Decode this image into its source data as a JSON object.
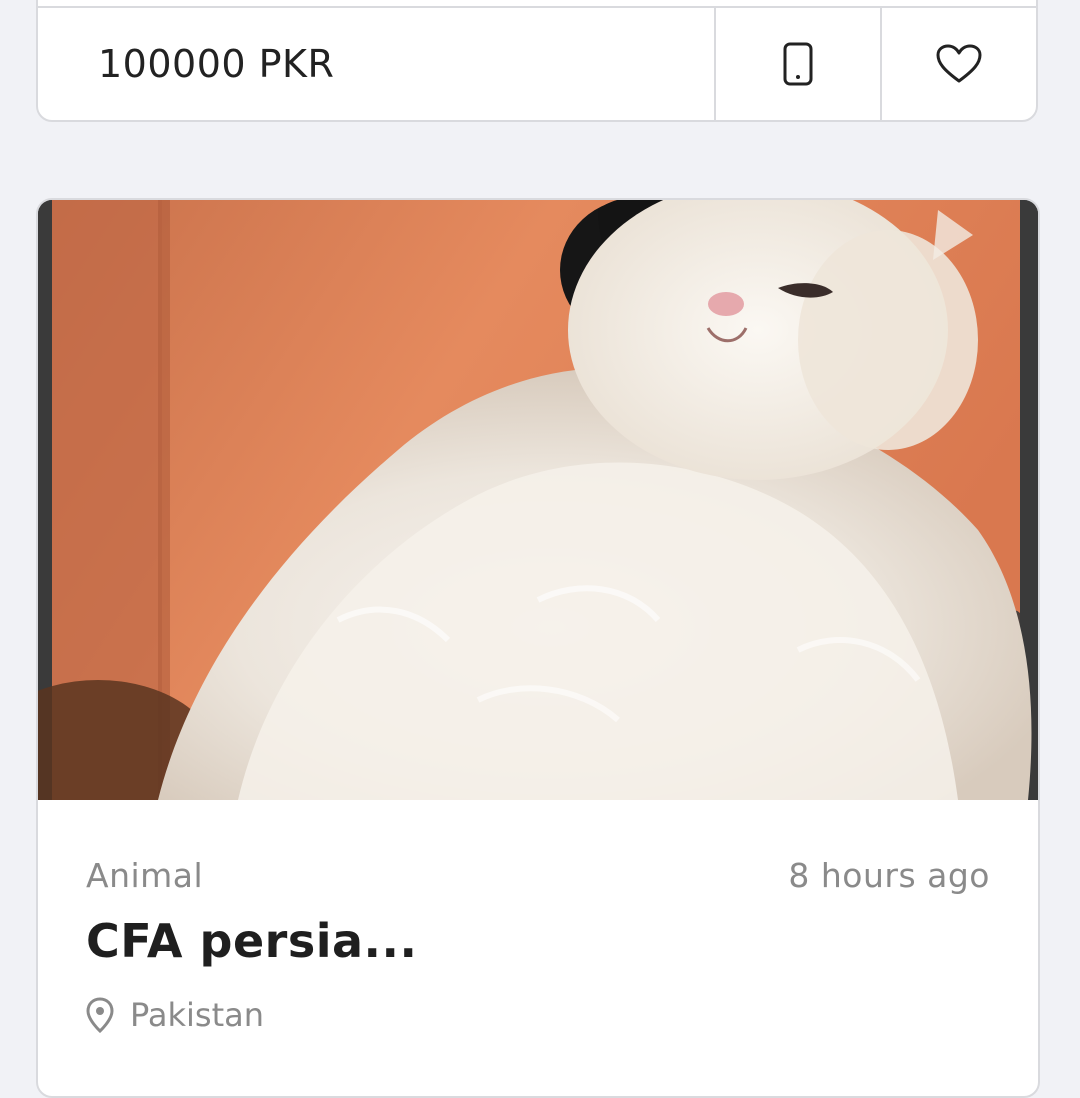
{
  "previous_listing": {
    "price": "100000 PKR",
    "call_icon": "smartphone-icon",
    "favorite_icon": "heart-outline-icon"
  },
  "listing": {
    "image_alt": "white Persian cat",
    "category": "Animal",
    "posted_time": "8 hours ago",
    "title": "CFA persia...",
    "location_icon": "map-pin-icon",
    "location": "Pakistan"
  },
  "colors": {
    "background": "#f1f2f6",
    "card": "#ffffff",
    "border": "#d9dade",
    "text_primary": "#222222",
    "text_secondary": "#8a8a8a"
  }
}
